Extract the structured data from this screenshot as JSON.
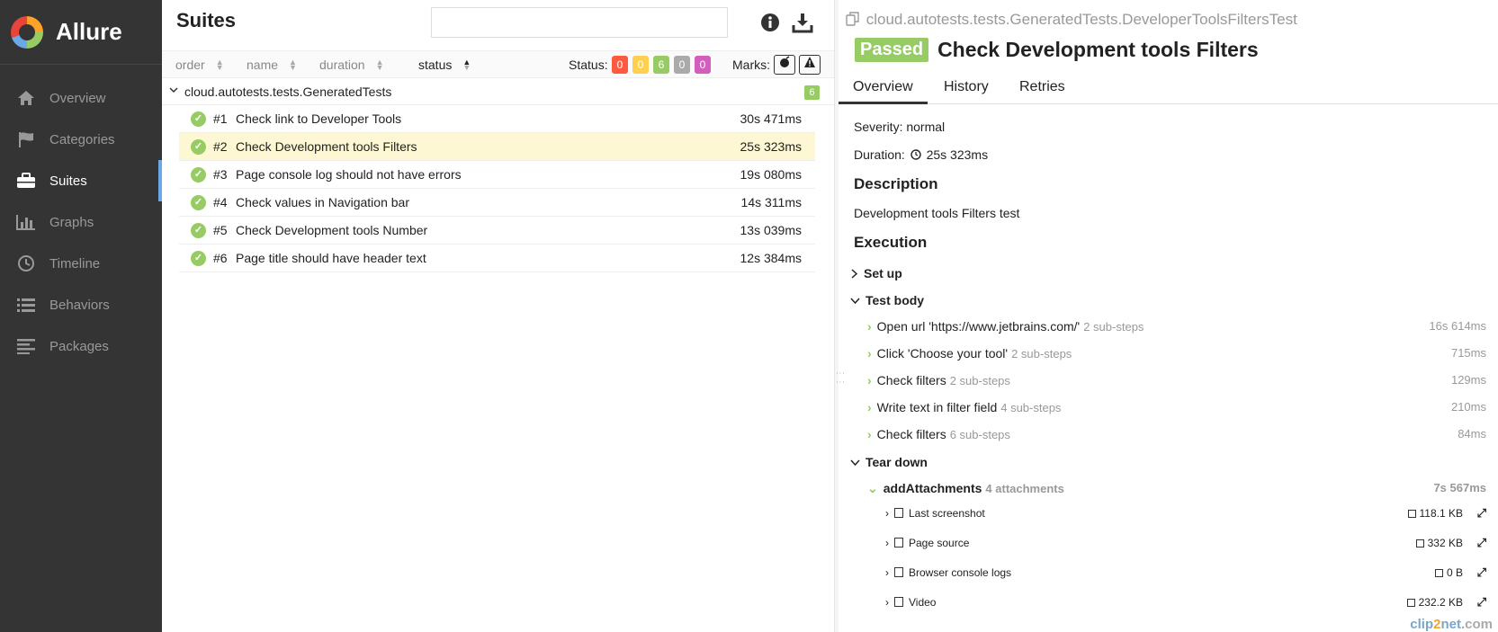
{
  "brand": {
    "name": "Allure"
  },
  "sidebar": {
    "items": [
      {
        "label": "Overview",
        "icon": "home-icon"
      },
      {
        "label": "Categories",
        "icon": "flag-icon"
      },
      {
        "label": "Suites",
        "icon": "briefcase-icon",
        "active": true
      },
      {
        "label": "Graphs",
        "icon": "bar-chart-icon"
      },
      {
        "label": "Timeline",
        "icon": "clock-icon"
      },
      {
        "label": "Behaviors",
        "icon": "list-icon"
      },
      {
        "label": "Packages",
        "icon": "align-left-icon"
      }
    ]
  },
  "suites": {
    "title": "Suites",
    "sort": {
      "order": "order",
      "name": "name",
      "duration": "duration",
      "status": "status"
    },
    "status_label": "Status:",
    "status_counts": [
      "0",
      "0",
      "6",
      "0",
      "0"
    ],
    "status_colors": [
      "#fd5a3e",
      "#ffd050",
      "#97cc64",
      "#aaaaaa",
      "#d35ebe"
    ],
    "marks_label": "Marks:",
    "group": {
      "name": "cloud.autotests.tests.GeneratedTests",
      "count": "6"
    },
    "tests": [
      {
        "num": "#1",
        "name": "Check link to Developer Tools",
        "duration": "30s 471ms"
      },
      {
        "num": "#2",
        "name": "Check Development tools Filters",
        "duration": "25s 323ms",
        "selected": true
      },
      {
        "num": "#3",
        "name": "Page console log should not have errors",
        "duration": "19s 080ms"
      },
      {
        "num": "#4",
        "name": "Check values in Navigation bar",
        "duration": "14s 311ms"
      },
      {
        "num": "#5",
        "name": "Check Development tools Number",
        "duration": "13s 039ms"
      },
      {
        "num": "#6",
        "name": "Page title should have header text",
        "duration": "12s 384ms"
      }
    ]
  },
  "detail": {
    "path": "cloud.autotests.tests.GeneratedTests.DeveloperToolsFiltersTest",
    "status": "Passed",
    "title": "Check Development tools Filters",
    "tabs": [
      "Overview",
      "History",
      "Retries"
    ],
    "severity": "Severity: normal",
    "duration_label": "Duration:",
    "duration": "25s 323ms",
    "description_heading": "Description",
    "description": "Development tools Filters test",
    "execution_heading": "Execution",
    "setup": "Set up",
    "test_body": "Test body",
    "steps": [
      {
        "name": "Open url 'https://www.jetbrains.com/'",
        "sub": "2 sub-steps",
        "duration": "16s 614ms"
      },
      {
        "name": "Click 'Choose your tool'",
        "sub": "2 sub-steps",
        "duration": "715ms"
      },
      {
        "name": "Check filters",
        "sub": "2 sub-steps",
        "duration": "129ms"
      },
      {
        "name": "Write text in filter field",
        "sub": "4 sub-steps",
        "duration": "210ms"
      },
      {
        "name": "Check filters",
        "sub": "6 sub-steps",
        "duration": "84ms"
      }
    ],
    "teardown": "Tear down",
    "teardown_step": {
      "name": "addAttachments",
      "sub": "4 attachments",
      "duration": "7s 567ms"
    },
    "attachments": [
      {
        "name": "Last screenshot",
        "size": "118.1 KB"
      },
      {
        "name": "Page source",
        "size": "332 KB"
      },
      {
        "name": "Browser console logs",
        "size": "0 B"
      },
      {
        "name": "Video",
        "size": "232.2 KB"
      }
    ]
  },
  "watermark": {
    "a": "clip",
    "b": "2",
    "c": "net",
    "d": ".com"
  }
}
